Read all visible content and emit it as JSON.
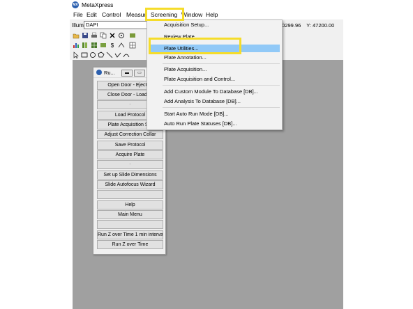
{
  "app": {
    "title": "MetaXpress",
    "logo_text": "MX"
  },
  "menubar": {
    "items": [
      "File",
      "Edit",
      "Control",
      "Measur",
      "Screening",
      "Window",
      "Help"
    ],
    "active": "Screening"
  },
  "toolbar": {
    "illum_label": "Illum:",
    "illum_value": "DAPI",
    "coord_x": "60299.96",
    "coord_y": "Y: 47200.00",
    "icons": [
      "open-folder-icon",
      "save-icon",
      "print-icon",
      "copy-icon",
      "close-x-icon",
      "target-icon"
    ]
  },
  "panel": {
    "title": "Ru...",
    "buttons": [
      "Open Door - Eject Pl",
      "Close Door - Load Pl",
      "-",
      "Load Protocol",
      "Plate Acquisition Set",
      "Adjust Correction Collar",
      "Save Protocol",
      "Acquire Plate",
      "-",
      "Set up Slide Dimensions",
      "Slide Autofocus Wizard",
      "",
      "Help",
      "Main Menu",
      "",
      "Run Z over Time 1 min interval",
      "Run Z over Time"
    ]
  },
  "screening_menu": {
    "items": [
      "Acquisition Setup...",
      "Review Plate...",
      "Plate Utilities...",
      "Plate Annotation...",
      "Plate Acquisition...",
      "Plate Acquisition and Control...",
      "Add Custom Module To Database [DB]...",
      "Add Analysis To Database [DB]...",
      "Start Auto Run Mode [DB]...",
      "Auto Run Plate Statuses [DB]..."
    ],
    "highlighted": "Plate Utilities..."
  },
  "colors": {
    "highlight_box": "#f5dc2a",
    "menu_hover": "#91c9f7",
    "workspace": "#a0a0a0"
  }
}
